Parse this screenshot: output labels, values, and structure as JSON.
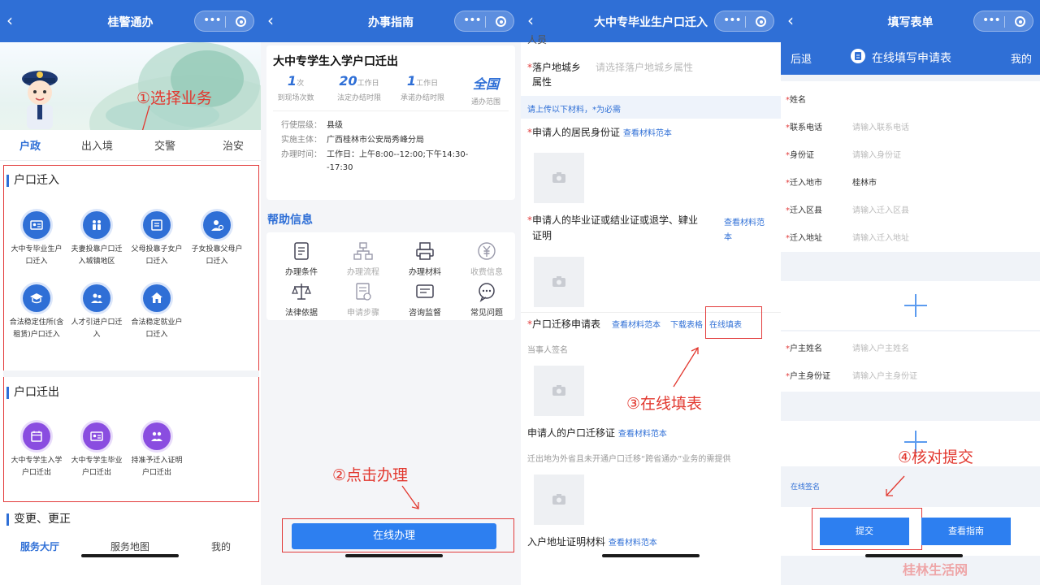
{
  "panel1": {
    "title": "桂警通办",
    "annotation": "①选择业务",
    "tabs": [
      "户政",
      "出入境",
      "交警",
      "治安"
    ],
    "section_in": {
      "title": "户口迁入",
      "items": [
        {
          "label": "大中专毕业生户口迁入",
          "icon": "id-card-icon"
        },
        {
          "label": "夫妻投靠户口迁入城镇地区",
          "icon": "couple-icon"
        },
        {
          "label": "父母投靠子女户口迁入",
          "icon": "document-icon"
        },
        {
          "label": "子女投靠父母户口迁入",
          "icon": "user-location-icon"
        },
        {
          "label": "合法稳定住所(含租赁)户口迁入",
          "icon": "graduation-cap-icon"
        },
        {
          "label": "人才引进户口迁入",
          "icon": "users-icon"
        },
        {
          "label": "合法稳定就业户口迁入",
          "icon": "house-icon"
        }
      ]
    },
    "section_out": {
      "title": "户口迁出",
      "items": [
        {
          "label": "大中专学生入学户口迁出",
          "icon": "calendar-icon"
        },
        {
          "label": "大中专学生毕业户口迁出",
          "icon": "id-card-icon"
        },
        {
          "label": "持准予迁入证明户口迁出",
          "icon": "handshake-icon"
        }
      ]
    },
    "section_change": "变更、更正",
    "bottom_nav": [
      "服务大厅",
      "服务地图",
      "我的"
    ]
  },
  "panel2": {
    "title": "办事指南",
    "service_name": "大中专学生入学户口迁出",
    "stats": [
      {
        "num": "1",
        "unit": "次",
        "label": "到现场次数"
      },
      {
        "num": "20",
        "unit": "工作日",
        "label": "法定办结时限"
      },
      {
        "num": "1",
        "unit": "工作日",
        "label": "承诺办结时限"
      },
      {
        "num": "全国",
        "unit": "",
        "label": "通办范围"
      }
    ],
    "info": [
      {
        "k": "行使层级：",
        "v": "县级"
      },
      {
        "k": "实施主体：",
        "v": "广西桂林市公安局秀峰分局"
      },
      {
        "k": "办理时间：",
        "v": "工作日：上午8:00--12:00;下午14:30--17:30"
      }
    ],
    "help_title": "帮助信息",
    "help_items": [
      {
        "label": "办理条件",
        "icon": "checklist-icon",
        "dim": false
      },
      {
        "label": "办理流程",
        "icon": "flowchart-icon",
        "dim": true
      },
      {
        "label": "办理材料",
        "icon": "printer-icon",
        "dim": false
      },
      {
        "label": "收费信息",
        "icon": "yuan-icon",
        "dim": true
      },
      {
        "label": "法律依据",
        "icon": "scales-icon",
        "dim": false
      },
      {
        "label": "申请步骤",
        "icon": "form-check-icon",
        "dim": true
      },
      {
        "label": "咨询监督",
        "icon": "chat-window-icon",
        "dim": false
      },
      {
        "label": "常见问题",
        "icon": "speech-bubble-icon",
        "dim": false
      }
    ],
    "annotation": "②点击办理",
    "button": "在线办理"
  },
  "panel3": {
    "title": "大中专毕业生户口迁入",
    "top_partial": "人员",
    "field_label_1": "落户地城乡",
    "field_label_2": "属性",
    "field_placeholder": "请选择落户地城乡属性",
    "note": "请上传以下材料，*为必需",
    "materials": {
      "m1_title": "申请人的居民身份证",
      "m2_title_1": "申请人的毕业证或结业证或退学、肄业",
      "m2_title_2": "证明",
      "m3_title": "户口迁移申请表",
      "m3_sign": "当事人签名",
      "m4_title": "申请人的户口迁移证",
      "m4_desc": "迁出地为外省且未开通户口迁移“跨省通办”业务的需提供",
      "m5_title": "入户地址证明材料"
    },
    "link_sample": "查看材料范本",
    "link_sample_1": "查看材料范",
    "link_sample_2": "本",
    "link_download": "下载表格",
    "link_online": "在线填表",
    "annotation": "③在线填表"
  },
  "panel4": {
    "title": "填写表单",
    "back": "后退",
    "sub_title": "在线填写申请表",
    "mine": "我的",
    "fields": [
      {
        "label": "姓名",
        "value": ""
      },
      {
        "label": "联系电话",
        "value": "请输入联系电话"
      },
      {
        "label": "身份证",
        "value": "请输入身份证"
      },
      {
        "label": "迁入地市",
        "value": "桂林市"
      },
      {
        "label": "迁入区县",
        "value": "请输入迁入区县"
      },
      {
        "label": "迁入地址",
        "value": "请输入迁入地址"
      }
    ],
    "fields2": [
      {
        "label": "户主姓名",
        "value": "请输入户主姓名"
      },
      {
        "label": "户主身份证",
        "value": "请输入户主身份证"
      }
    ],
    "signature": "在线签名",
    "annotation": "④核对提交",
    "submit": "提交",
    "guide": "查看指南",
    "watermark": "桂林生活网"
  }
}
